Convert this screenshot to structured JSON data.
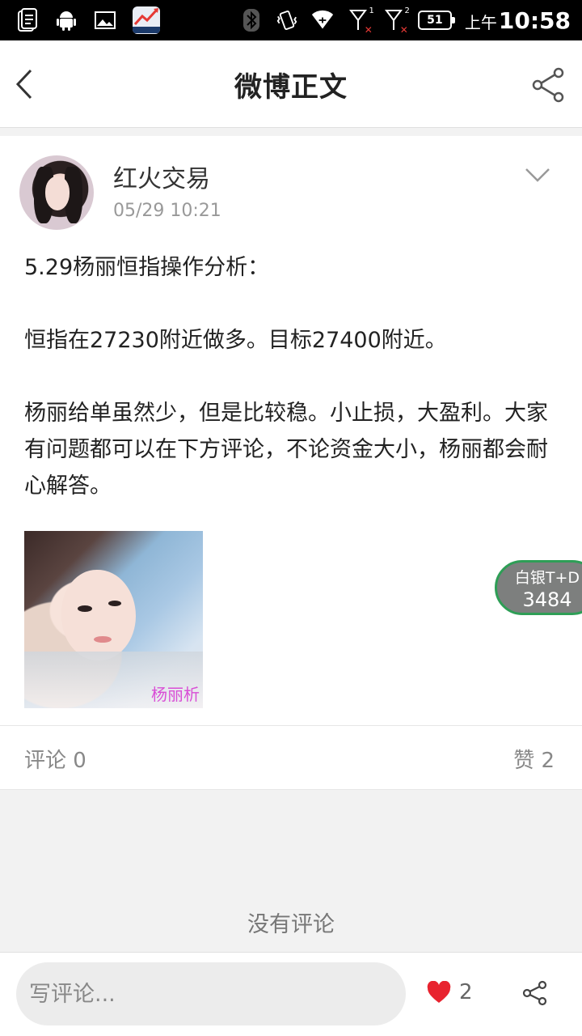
{
  "status_bar": {
    "battery": "51",
    "ampm": "上午",
    "time": "10:58",
    "signal_1_label": "1",
    "signal_2_label": "2",
    "icons": [
      "file-icon",
      "android-icon",
      "image-icon",
      "app-icon",
      "bluetooth-icon",
      "vibrate-icon",
      "wifi-icon",
      "signal-icon",
      "signal-icon",
      "battery-icon"
    ]
  },
  "nav": {
    "title": "微博正文",
    "back_icon": "back-arrow-icon",
    "share_icon": "share-icon"
  },
  "post": {
    "author": "红火交易",
    "time": "05/29 10:21",
    "paragraphs": [
      "5.29杨丽恒指操作分析：",
      "恒指在27230附近做多。目标27400附近。",
      "杨丽给单虽然少，但是比较稳。小止损，大盈利。大家有问题都可以在下方评论，不论资金大小，杨丽都会耐心解答。"
    ],
    "image_watermark": "杨丽析"
  },
  "float_tag": {
    "label": "白银T+D",
    "value": "3484"
  },
  "stats": {
    "comments": "评论 0",
    "likes": "赞 2"
  },
  "empty_comments": "没有评论",
  "bottom_bar": {
    "comment_placeholder": "写评论...",
    "like_count": "2"
  },
  "colors": {
    "heart": "#e8232f",
    "float_border": "#2e9e56",
    "watermark": "#d94fd6"
  }
}
